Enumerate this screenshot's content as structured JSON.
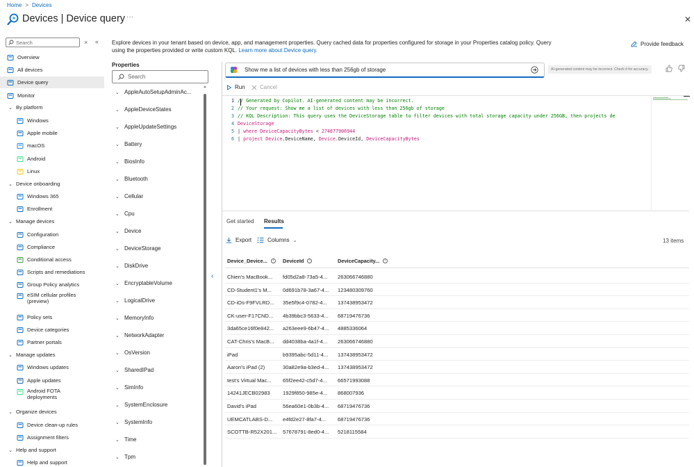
{
  "breadcrumb": [
    "Home",
    "Devices"
  ],
  "title": "Devices | Device query",
  "more": "···",
  "close": "✕",
  "sidebar": {
    "search_placeholder": "Search",
    "items": [
      {
        "label": "Overview",
        "icon": "info-icon",
        "kind": "item"
      },
      {
        "label": "All devices",
        "icon": "devices-icon",
        "kind": "item"
      },
      {
        "label": "Device query",
        "icon": "query-icon",
        "kind": "item",
        "selected": true
      },
      {
        "label": "Monitor",
        "icon": "monitor-icon",
        "kind": "item"
      },
      {
        "label": "By platform",
        "kind": "group"
      },
      {
        "label": "Windows",
        "icon": "windows-icon",
        "kind": "sub"
      },
      {
        "label": "Apple mobile",
        "icon": "phone-icon",
        "kind": "sub"
      },
      {
        "label": "macOS",
        "icon": "laptop-icon",
        "kind": "sub"
      },
      {
        "label": "Android",
        "icon": "android-icon",
        "kind": "sub"
      },
      {
        "label": "Linux",
        "icon": "linux-icon",
        "kind": "sub"
      },
      {
        "label": "Device onboarding",
        "kind": "group"
      },
      {
        "label": "Windows 365",
        "icon": "cloud-pc-icon",
        "kind": "sub"
      },
      {
        "label": "Enrollment",
        "icon": "enrollment-icon",
        "kind": "sub"
      },
      {
        "label": "Manage devices",
        "kind": "group"
      },
      {
        "label": "Configuration",
        "icon": "configuration-icon",
        "kind": "sub"
      },
      {
        "label": "Compliance",
        "icon": "compliance-icon",
        "kind": "sub"
      },
      {
        "label": "Conditional access",
        "icon": "shield-icon",
        "kind": "sub"
      },
      {
        "label": "Scripts and remediations",
        "icon": "script-icon",
        "kind": "sub"
      },
      {
        "label": "Group Policy analytics",
        "icon": "analytics-icon",
        "kind": "sub"
      },
      {
        "label": "eSIM cellular profiles\n(preview)",
        "icon": "esim-icon",
        "kind": "sub2"
      },
      {
        "label": "Policy sets",
        "icon": "policy-icon",
        "kind": "sub"
      },
      {
        "label": "Device categories",
        "icon": "categories-icon",
        "kind": "sub"
      },
      {
        "label": "Partner portals",
        "icon": "portal-icon",
        "kind": "sub"
      },
      {
        "label": "Manage updates",
        "kind": "group"
      },
      {
        "label": "Windows updates",
        "icon": "windows-update-icon",
        "kind": "sub"
      },
      {
        "label": "Apple updates",
        "icon": "apple-update-icon",
        "kind": "sub"
      },
      {
        "label": "Android FOTA\ndeployments",
        "icon": "android-update-icon",
        "kind": "sub2"
      },
      {
        "label": "Organize devices",
        "kind": "group"
      },
      {
        "label": "Device clean-up rules",
        "icon": "cleanup-icon",
        "kind": "sub"
      },
      {
        "label": "Assignment filters",
        "icon": "filter-icon",
        "kind": "sub"
      },
      {
        "label": "Help and support",
        "kind": "group"
      },
      {
        "label": "Help and support",
        "icon": "help-icon",
        "kind": "sub"
      }
    ]
  },
  "intro": {
    "text": "Explore devices in your tenant based on device, app, and management properties. Query cached data for properties configured for storage in your Properties catalog policy. Query using the properties provided or write custom KQL.",
    "link": "Learn more about Device query."
  },
  "feedback_label": "Provide feedback",
  "properties": {
    "title": "Properties",
    "search_placeholder": "Search",
    "items": [
      "AppleAutoSetupAdminAc...",
      "AppleDeviceStates",
      "AppleUpdateSettings",
      "Battery",
      "BiosInfo",
      "Bluetooth",
      "Cellular",
      "Cpu",
      "Device",
      "DeviceStorage",
      "DiskDrive",
      "EncryptableVolume",
      "LogicalDrive",
      "MemoryInfo",
      "NetworkAdapter",
      "OsVersion",
      "SharedIPad",
      "SimInfo",
      "SystemEnclosure",
      "SystemInfo",
      "Time",
      "Tpm"
    ]
  },
  "prompt": {
    "value": "Show me a list of devices with less than 256gb of storage",
    "ai_note": "AI-generated content may be incorrect. Check it for accuracy."
  },
  "toolbar": {
    "run": "Run",
    "cancel": "Cancel"
  },
  "code": [
    [
      {
        "t": "// Generated by Copilot. AI-generated content may be incorrect.",
        "c": "cm"
      }
    ],
    [
      {
        "t": "// Your request: Show me a list of devices with less than 256gb of storage",
        "c": "cm"
      }
    ],
    [
      {
        "t": "// KQL Description: This query uses the DeviceStorage table to filter devices with total storage capacity under 256GB, then projects de",
        "c": "cm"
      }
    ],
    [
      {
        "t": "DeviceStorage",
        "c": "kw"
      }
    ],
    [
      {
        "t": "| ",
        "c": "pl"
      },
      {
        "t": "where ",
        "c": "kw"
      },
      {
        "t": "DeviceCapacityBytes",
        "c": "kw"
      },
      {
        "t": " < ",
        "c": "pl"
      },
      {
        "t": "274877906944",
        "c": "kw"
      }
    ],
    [
      {
        "t": "| ",
        "c": "pl"
      },
      {
        "t": "project ",
        "c": "kw"
      },
      {
        "t": "Device",
        "c": "kw"
      },
      {
        "t": ".DeviceName, ",
        "c": "pl"
      },
      {
        "t": "Device",
        "c": "kw"
      },
      {
        "t": ".DeviceId, ",
        "c": "pl"
      },
      {
        "t": "DeviceCapacityBytes",
        "c": "kw"
      }
    ]
  ],
  "tabs": {
    "get_started": "Get started",
    "results": "Results"
  },
  "results_toolbar": {
    "export": "Export",
    "columns": "Columns",
    "count": "13 items"
  },
  "table": {
    "columns": [
      "Device_Device...",
      "DeviceId",
      "DeviceCapacity..."
    ],
    "rows": [
      [
        "Chien's MacBook...",
        "fd05d2a8-73a5-4...",
        "263066746880"
      ],
      [
        "CD-Student1's M...",
        "0d691b78-3a67-4...",
        "123480309760"
      ],
      [
        "CD-iOs-F9FVLRD...",
        "35e5f9c4-0782-4...",
        "137438953472"
      ],
      [
        "CK-user-F17CND...",
        "4b39bbc3-5633-4...",
        "68719476736"
      ],
      [
        "3da65ce16f0e842...",
        "a263eee9-6b47-4...",
        "4885336064"
      ],
      [
        "CAT-Chris's MacB...",
        "dd4038ba-4a1f-4...",
        "263066746880"
      ],
      [
        "iPad",
        "b9395abc-5d11-4...",
        "137438953472"
      ],
      [
        "Aaron's iPad (2)",
        "30a82e9a-b3ed-4...",
        "137438953472"
      ],
      [
        "test's Virtual Mac...",
        "65f2ee42-c5d7-4...",
        "66571993088"
      ],
      [
        "14241JECB02983",
        "1929f850-985e-4...",
        "868007936"
      ],
      [
        "David's iPad",
        "56ea60e1-0b3b-4...",
        "68719476736"
      ],
      [
        "UEMCATLABS-D...",
        "e4fd2e27-8fa7-4...",
        "68719476736"
      ],
      [
        "SCOTTB-R52X201...",
        "57678791-8ed0-4...",
        "5218115584"
      ]
    ]
  },
  "colors": {
    "accent": "#0f6cbd",
    "selected_bg": "#ebebeb",
    "comment": "#008000",
    "keyword": "#c41a7a"
  }
}
